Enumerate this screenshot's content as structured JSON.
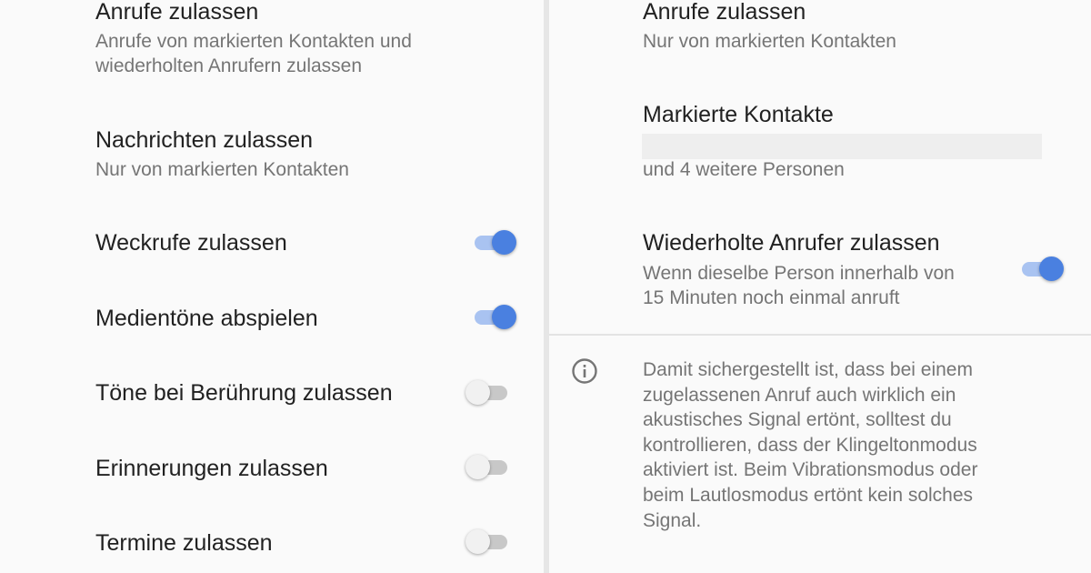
{
  "left": {
    "calls": {
      "title": "Anrufe zulassen",
      "line1": "Anrufe von markierten Kontakten und",
      "line2": "wiederholten Anrufern zulassen"
    },
    "messages": {
      "title": "Nachrichten zulassen",
      "subtitle": "Nur von markierten Kontakten"
    },
    "toggles": [
      {
        "label": "Weckrufe zulassen",
        "state": "on"
      },
      {
        "label": "Medientöne abspielen",
        "state": "on"
      },
      {
        "label": "Töne bei Berührung zulassen",
        "state": "off"
      },
      {
        "label": "Erinnerungen zulassen",
        "state": "off"
      },
      {
        "label": "Termine zulassen",
        "state": "off"
      }
    ]
  },
  "right": {
    "calls": {
      "title": "Anrufe zulassen",
      "subtitle": "Nur von markierten Kontakten"
    },
    "starred": {
      "title": "Markierte Kontakte",
      "subtitle": "und 4 weitere Personen"
    },
    "repeat_callers": {
      "title": "Wiederholte Anrufer zulassen",
      "line1": "Wenn dieselbe Person innerhalb von",
      "line2": "15 Minuten noch einmal anruft",
      "state": "on"
    },
    "info": {
      "icon": "info-icon",
      "lines": [
        "Damit sichergestellt ist, dass bei einem",
        "zugelassenen Anruf auch wirklich ein",
        "akustisches Signal ertönt, solltest du",
        "kontrollieren, dass der Klingeltonmodus",
        "aktiviert ist. Beim Vibrationsmodus oder",
        "beim Lautlosmodus ertönt kein solches",
        "Signal."
      ]
    }
  },
  "colors": {
    "background": "#fafafa",
    "accent": "#4a80e0",
    "accent_track": "#a9c3f1",
    "title_text": "#212121",
    "secondary_text": "#757575"
  }
}
